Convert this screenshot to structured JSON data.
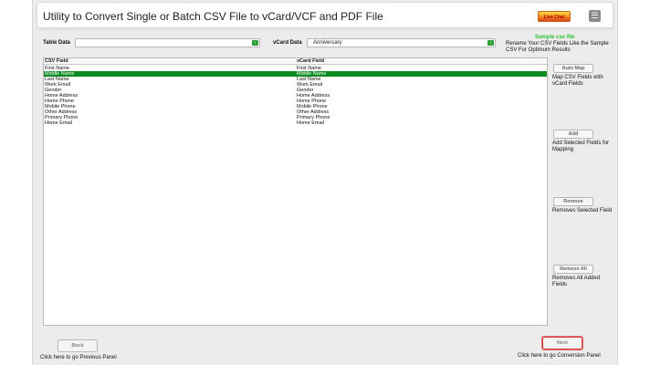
{
  "header": {
    "title": "Utility to Convert Single or Batch CSV File to vCard/VCF and PDF File",
    "live_chat": "Live Chat",
    "menu_icon": "hamburger-menu-icon"
  },
  "form": {
    "table_data_label": "Table Data",
    "table_data_value": "",
    "vcard_data_label": "vCard Data",
    "vcard_data_value": "Anniversary"
  },
  "sample": {
    "link": "Sample csv file",
    "note": "Rename Your CSV Fields Like the Sample CSV For Optimum Results"
  },
  "table": {
    "columns": [
      "CSV Field",
      "vCard Field"
    ],
    "selected_index": 1,
    "rows": [
      [
        "First Name",
        "First Name"
      ],
      [
        "Middle Name",
        "Middle Name"
      ],
      [
        "Last Name",
        "Last Name"
      ],
      [
        "Work Email",
        "Work Email"
      ],
      [
        "Gender",
        "Gender"
      ],
      [
        "Home Address",
        "Home Address"
      ],
      [
        "Home Phone",
        "Home Phone"
      ],
      [
        "Mobile Phone",
        "Mobile Phone"
      ],
      [
        "Other Address",
        "Other Address"
      ],
      [
        "Primary Phone",
        "Primary Phone"
      ],
      [
        "Home Email",
        "Home Email"
      ]
    ]
  },
  "actions": {
    "auto_map": {
      "label": "Auto Map",
      "help": "Map CSV Fields with vCard Fields"
    },
    "add": {
      "label": "Add",
      "help": "Add Selected Fields for Mapping"
    },
    "remove": {
      "label": "Remove",
      "help": "Removes Selected Field"
    },
    "remove_all": {
      "label": "Remove All",
      "help": "Removes All Added Fields"
    }
  },
  "footer": {
    "back_label": "Back",
    "back_help": "Click here to go Previous Panel",
    "next_label": "Next",
    "next_help": "Click here to go Conversion Panel"
  },
  "colors": {
    "selected_row": "#0a8a1f",
    "sample_link": "#2fc22f",
    "next_highlight": "#d83a3a"
  }
}
